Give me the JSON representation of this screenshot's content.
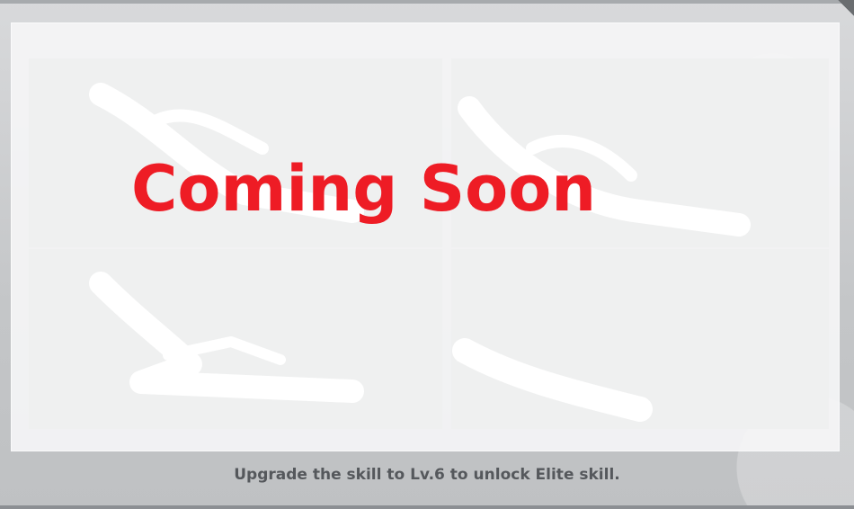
{
  "elite_skill_panel": {
    "status_text": "Coming Soon",
    "status_color": "#ee1c25",
    "unlock_hint": "Upgrade the skill to Lv.6 to unlock Elite skill.",
    "skill_slots": [
      {
        "state": "locked",
        "icon": "skill-silhouette-icon"
      },
      {
        "state": "locked",
        "icon": "skill-silhouette-icon"
      },
      {
        "state": "locked",
        "icon": "skill-silhouette-icon"
      },
      {
        "state": "locked",
        "icon": "skill-silhouette-icon"
      }
    ]
  }
}
